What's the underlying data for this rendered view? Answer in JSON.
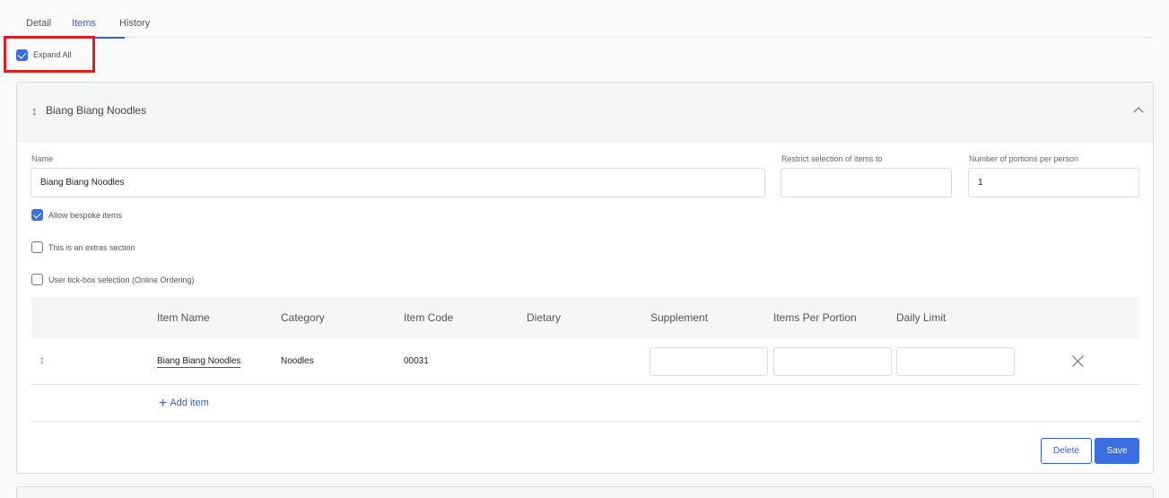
{
  "tabs": [
    {
      "label": "Detail",
      "active": false
    },
    {
      "label": "Items",
      "active": true
    },
    {
      "label": "History",
      "active": false
    }
  ],
  "expand_all": {
    "label": "Expand All",
    "checked": true
  },
  "section": {
    "title": "Biang Biang Noodles",
    "fields": {
      "name_label": "Name",
      "name_value": "Biang Biang Noodles",
      "restrict_label": "Restrict selection of items to",
      "restrict_value": "",
      "portions_label": "Number of portions per person",
      "portions_value": "1"
    },
    "options": [
      {
        "label": "Allow bespoke items",
        "checked": true
      },
      {
        "label": "This is an extras section",
        "checked": false
      },
      {
        "label": "User tick-box selection (Online Ordering)",
        "checked": false
      }
    ],
    "table": {
      "columns": [
        "Item Name",
        "Category",
        "Item Code",
        "Dietary",
        "Supplement",
        "Items Per Portion",
        "Daily Limit"
      ],
      "rows": [
        {
          "name": "Biang Biang Noodles",
          "category": "Noodles",
          "code": "00031",
          "dietary": "",
          "supplement": "",
          "items_per_portion": "",
          "daily_limit": ""
        }
      ]
    },
    "add_item_label": "Add item",
    "delete_label": "Delete",
    "save_label": "Save"
  },
  "colors": {
    "accent": "#3b6ee0",
    "highlight": "#e02020"
  },
  "icons": {
    "drag": "drag-handle-icon",
    "collapse": "chevron-up-icon",
    "remove": "close-icon",
    "add": "plus-icon"
  }
}
